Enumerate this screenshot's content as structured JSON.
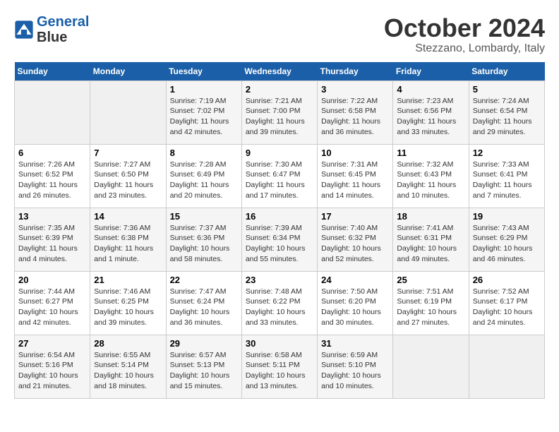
{
  "header": {
    "logo_line1": "General",
    "logo_line2": "Blue",
    "month": "October 2024",
    "location": "Stezzano, Lombardy, Italy"
  },
  "weekdays": [
    "Sunday",
    "Monday",
    "Tuesday",
    "Wednesday",
    "Thursday",
    "Friday",
    "Saturday"
  ],
  "weeks": [
    [
      {
        "day": "",
        "info": ""
      },
      {
        "day": "",
        "info": ""
      },
      {
        "day": "1",
        "info": "Sunrise: 7:19 AM\nSunset: 7:02 PM\nDaylight: 11 hours and 42 minutes."
      },
      {
        "day": "2",
        "info": "Sunrise: 7:21 AM\nSunset: 7:00 PM\nDaylight: 11 hours and 39 minutes."
      },
      {
        "day": "3",
        "info": "Sunrise: 7:22 AM\nSunset: 6:58 PM\nDaylight: 11 hours and 36 minutes."
      },
      {
        "day": "4",
        "info": "Sunrise: 7:23 AM\nSunset: 6:56 PM\nDaylight: 11 hours and 33 minutes."
      },
      {
        "day": "5",
        "info": "Sunrise: 7:24 AM\nSunset: 6:54 PM\nDaylight: 11 hours and 29 minutes."
      }
    ],
    [
      {
        "day": "6",
        "info": "Sunrise: 7:26 AM\nSunset: 6:52 PM\nDaylight: 11 hours and 26 minutes."
      },
      {
        "day": "7",
        "info": "Sunrise: 7:27 AM\nSunset: 6:50 PM\nDaylight: 11 hours and 23 minutes."
      },
      {
        "day": "8",
        "info": "Sunrise: 7:28 AM\nSunset: 6:49 PM\nDaylight: 11 hours and 20 minutes."
      },
      {
        "day": "9",
        "info": "Sunrise: 7:30 AM\nSunset: 6:47 PM\nDaylight: 11 hours and 17 minutes."
      },
      {
        "day": "10",
        "info": "Sunrise: 7:31 AM\nSunset: 6:45 PM\nDaylight: 11 hours and 14 minutes."
      },
      {
        "day": "11",
        "info": "Sunrise: 7:32 AM\nSunset: 6:43 PM\nDaylight: 11 hours and 10 minutes."
      },
      {
        "day": "12",
        "info": "Sunrise: 7:33 AM\nSunset: 6:41 PM\nDaylight: 11 hours and 7 minutes."
      }
    ],
    [
      {
        "day": "13",
        "info": "Sunrise: 7:35 AM\nSunset: 6:39 PM\nDaylight: 11 hours and 4 minutes."
      },
      {
        "day": "14",
        "info": "Sunrise: 7:36 AM\nSunset: 6:38 PM\nDaylight: 11 hours and 1 minute."
      },
      {
        "day": "15",
        "info": "Sunrise: 7:37 AM\nSunset: 6:36 PM\nDaylight: 10 hours and 58 minutes."
      },
      {
        "day": "16",
        "info": "Sunrise: 7:39 AM\nSunset: 6:34 PM\nDaylight: 10 hours and 55 minutes."
      },
      {
        "day": "17",
        "info": "Sunrise: 7:40 AM\nSunset: 6:32 PM\nDaylight: 10 hours and 52 minutes."
      },
      {
        "day": "18",
        "info": "Sunrise: 7:41 AM\nSunset: 6:31 PM\nDaylight: 10 hours and 49 minutes."
      },
      {
        "day": "19",
        "info": "Sunrise: 7:43 AM\nSunset: 6:29 PM\nDaylight: 10 hours and 46 minutes."
      }
    ],
    [
      {
        "day": "20",
        "info": "Sunrise: 7:44 AM\nSunset: 6:27 PM\nDaylight: 10 hours and 42 minutes."
      },
      {
        "day": "21",
        "info": "Sunrise: 7:46 AM\nSunset: 6:25 PM\nDaylight: 10 hours and 39 minutes."
      },
      {
        "day": "22",
        "info": "Sunrise: 7:47 AM\nSunset: 6:24 PM\nDaylight: 10 hours and 36 minutes."
      },
      {
        "day": "23",
        "info": "Sunrise: 7:48 AM\nSunset: 6:22 PM\nDaylight: 10 hours and 33 minutes."
      },
      {
        "day": "24",
        "info": "Sunrise: 7:50 AM\nSunset: 6:20 PM\nDaylight: 10 hours and 30 minutes."
      },
      {
        "day": "25",
        "info": "Sunrise: 7:51 AM\nSunset: 6:19 PM\nDaylight: 10 hours and 27 minutes."
      },
      {
        "day": "26",
        "info": "Sunrise: 7:52 AM\nSunset: 6:17 PM\nDaylight: 10 hours and 24 minutes."
      }
    ],
    [
      {
        "day": "27",
        "info": "Sunrise: 6:54 AM\nSunset: 5:16 PM\nDaylight: 10 hours and 21 minutes."
      },
      {
        "day": "28",
        "info": "Sunrise: 6:55 AM\nSunset: 5:14 PM\nDaylight: 10 hours and 18 minutes."
      },
      {
        "day": "29",
        "info": "Sunrise: 6:57 AM\nSunset: 5:13 PM\nDaylight: 10 hours and 15 minutes."
      },
      {
        "day": "30",
        "info": "Sunrise: 6:58 AM\nSunset: 5:11 PM\nDaylight: 10 hours and 13 minutes."
      },
      {
        "day": "31",
        "info": "Sunrise: 6:59 AM\nSunset: 5:10 PM\nDaylight: 10 hours and 10 minutes."
      },
      {
        "day": "",
        "info": ""
      },
      {
        "day": "",
        "info": ""
      }
    ]
  ]
}
